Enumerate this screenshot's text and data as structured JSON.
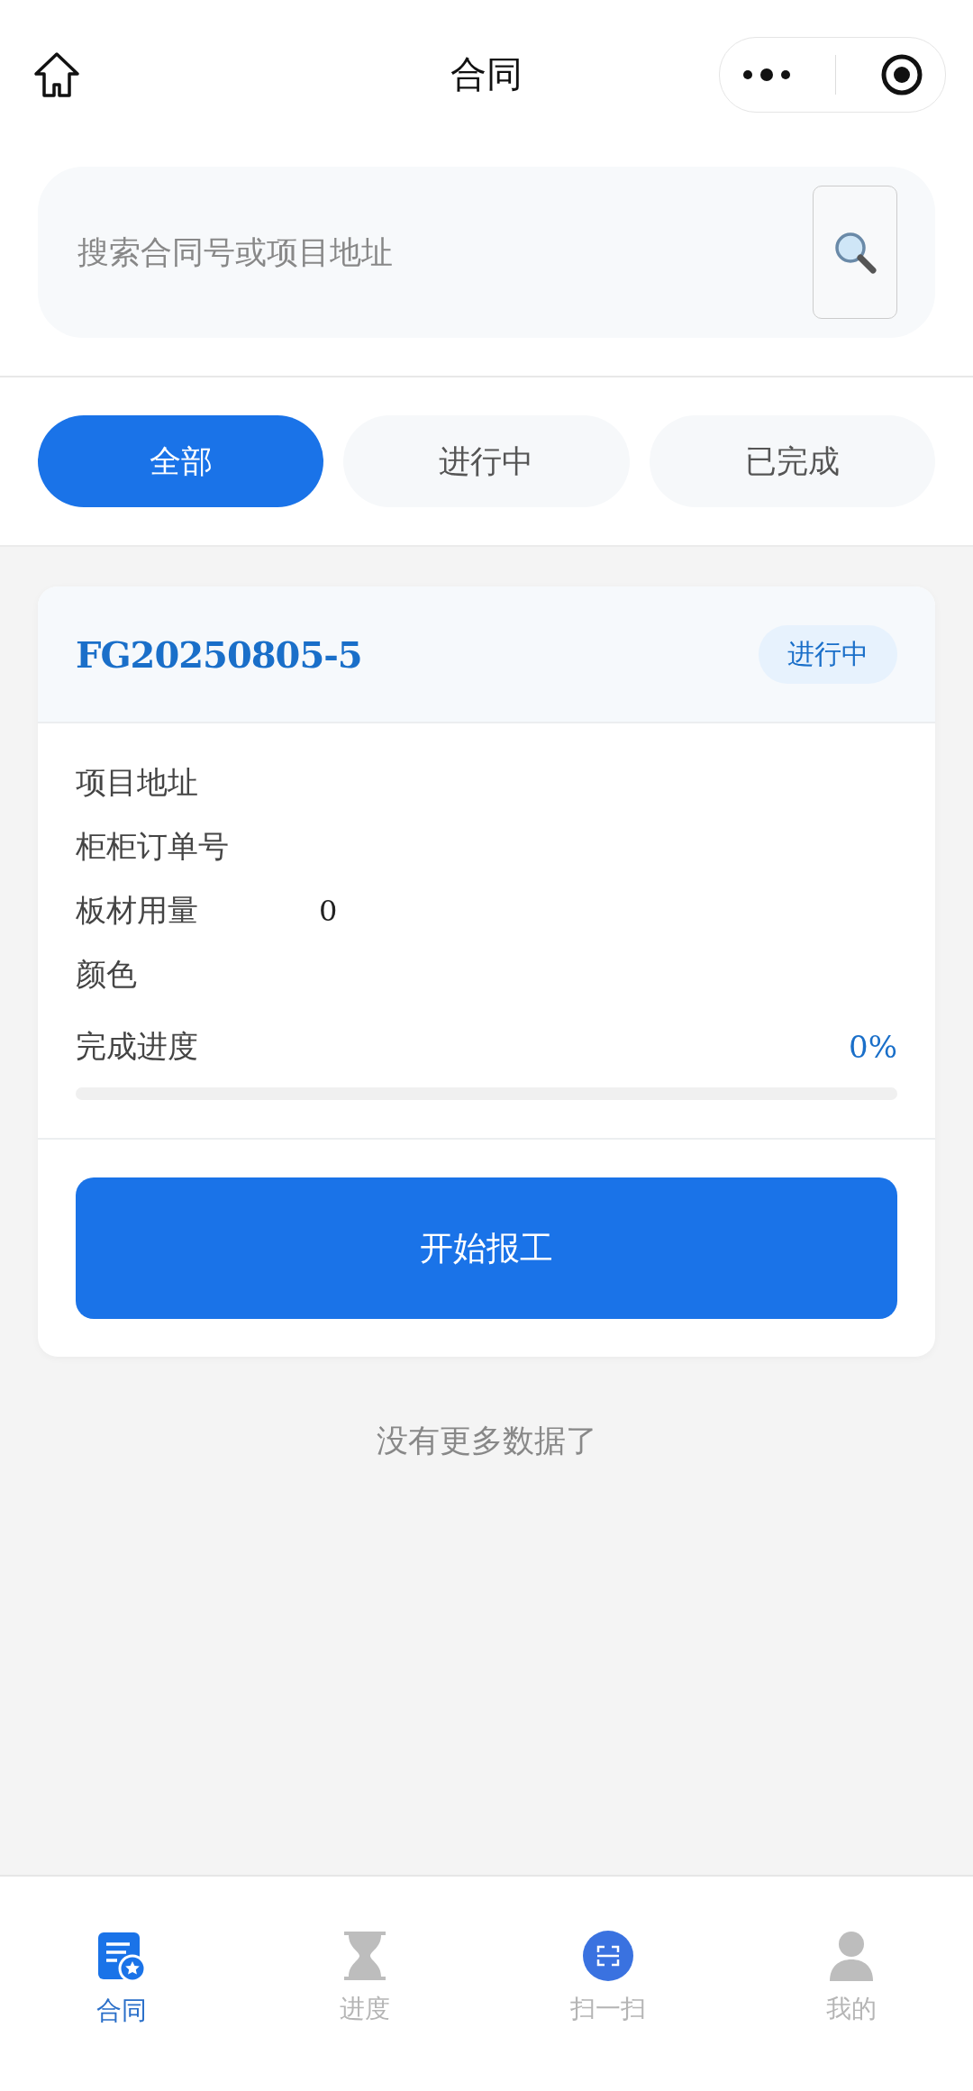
{
  "nav": {
    "title": "合同"
  },
  "search": {
    "placeholder": "搜索合同号或项目地址"
  },
  "filters": [
    {
      "label": "全部",
      "selected": true
    },
    {
      "label": "进行中",
      "selected": false
    },
    {
      "label": "已完成",
      "selected": false
    }
  ],
  "contracts": [
    {
      "number": "FG20250805-5",
      "status": "进行中",
      "fields": [
        {
          "label": "项目地址"
        },
        {
          "label": "柜柜订单号"
        },
        {
          "label": "板材用量",
          "value": "0"
        },
        {
          "label": "颜色"
        }
      ],
      "progress_label": "完成进度",
      "progress_reading": "0%",
      "level": 0,
      "action": "开始报工"
    }
  ],
  "list_end": "没有更多数据了",
  "tab_bar": [
    {
      "kind": "contract",
      "label": "合同",
      "selected": true
    },
    {
      "kind": "progress",
      "label": "进度",
      "selected": false
    },
    {
      "kind": "scan",
      "label": "扫一扫",
      "selected": false
    },
    {
      "kind": "profile",
      "label": "我的",
      "selected": false
    }
  ]
}
